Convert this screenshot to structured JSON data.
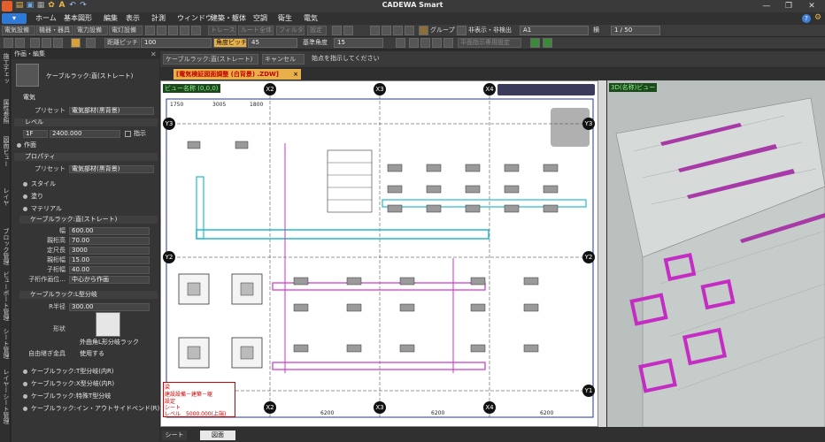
{
  "app": {
    "title": "CADEWA Smart"
  },
  "menu": {
    "app_button": "",
    "items": [
      "ホーム",
      "基本図形",
      "編集",
      "表示",
      "計測",
      "ウィンドウ",
      "建築・躯体",
      "空調",
      "衛生",
      "電気"
    ]
  },
  "toolbar1": {
    "buttons": [
      "電気設備",
      "機器・器具",
      "電力設備",
      "電灯設備"
    ],
    "trace": "トレース",
    "route_all": "ルート全体",
    "filter": "フィルター",
    "settings": "設定",
    "group": "グループ",
    "hide_detect": "非表示・非検出",
    "paper": "A1",
    "scale_label": "横",
    "scale": "1 / 50"
  },
  "toolbar2": {
    "pitch_label": "距離ピッチ",
    "pitch_value": "100",
    "angle_btn": "角度ピッチ",
    "angle_value": "45",
    "base_angle_label": "基準角度",
    "base_angle_value": "15",
    "plane_mode": "平面指示専用設定"
  },
  "vtabs": [
    "施工チェック",
    "属性参照",
    "図面ビュー",
    "レイヤー",
    "ブロック管理",
    "ビューポート管理",
    "シート管理",
    "レイヤーシート管理"
  ],
  "panel": {
    "header": "作画・編集",
    "current": "ケーブルラック:直(ストレート)",
    "electric": "電気",
    "preset_label": "プリセット",
    "preset_value": "電気部材(黒背景)",
    "level_section": "レベル",
    "level_floor": "1F",
    "level_value": "2400.000",
    "level_check": "指示",
    "draw_face": "作面",
    "property_section": "プロパティ",
    "preset2_value": "電気部材(黒背景)",
    "style": "スタイル",
    "paint": "塗り",
    "material": "マテリアル",
    "rack_section": "ケーブルラック:直(ストレート)",
    "props": [
      {
        "label": "幅",
        "value": "600.00"
      },
      {
        "label": "親桁高",
        "value": "70.00"
      },
      {
        "label": "定尺長",
        "value": "3000"
      },
      {
        "label": "親桁幅",
        "value": "15.00"
      },
      {
        "label": "子桁幅",
        "value": "40.00"
      },
      {
        "label": "子桁作画位...",
        "value": "中心から作画"
      }
    ],
    "branch_section": "ケーブルラック:L型分岐",
    "r_label": "R半径",
    "r_value": "300.00",
    "shape_label": "形状",
    "shape_value": "外曲角L形分岐ラック",
    "joint_label": "自由継ぎ金具",
    "joint_value": "使用する",
    "others": [
      "ケーブルラック:T型分岐(内R)",
      "ケーブルラック:X型分岐(内R)",
      "ケーブルラック:特殊T型分岐",
      "ケーブルラック:イン・アウトサイドベンド(R)"
    ]
  },
  "command": {
    "current": "ケーブルラック:直(ストレート)",
    "cancel": "キャンセル",
    "prompt": "始点を指示してください"
  },
  "document": {
    "tab": "[電気検証図面調整 (白背景) .ZDW]",
    "close": "×",
    "view_label": "ビュー名称 (0,0,0)",
    "view3d_label": "3D(名称)ビュー"
  },
  "plan": {
    "axes_x": [
      "X2",
      "X3",
      "X4"
    ],
    "axes_y": [
      "Y3",
      "Y2",
      "Y1"
    ],
    "dims_top": [
      "1750",
      "3005",
      "1800"
    ],
    "dims_bottom": [
      "6200",
      "6200",
      "6200"
    ],
    "legend": [
      "梁",
      "建設設備－建築－躯",
      "設定",
      "シート",
      "レベル",
      "5000.000(上端)"
    ]
  },
  "sheets": [
    "シート",
    "図面"
  ],
  "colors": {
    "accent": "#e7b04a",
    "magenta": "#cc33cc",
    "cyan": "#22bbcc",
    "appblue": "#2d7ad8"
  }
}
